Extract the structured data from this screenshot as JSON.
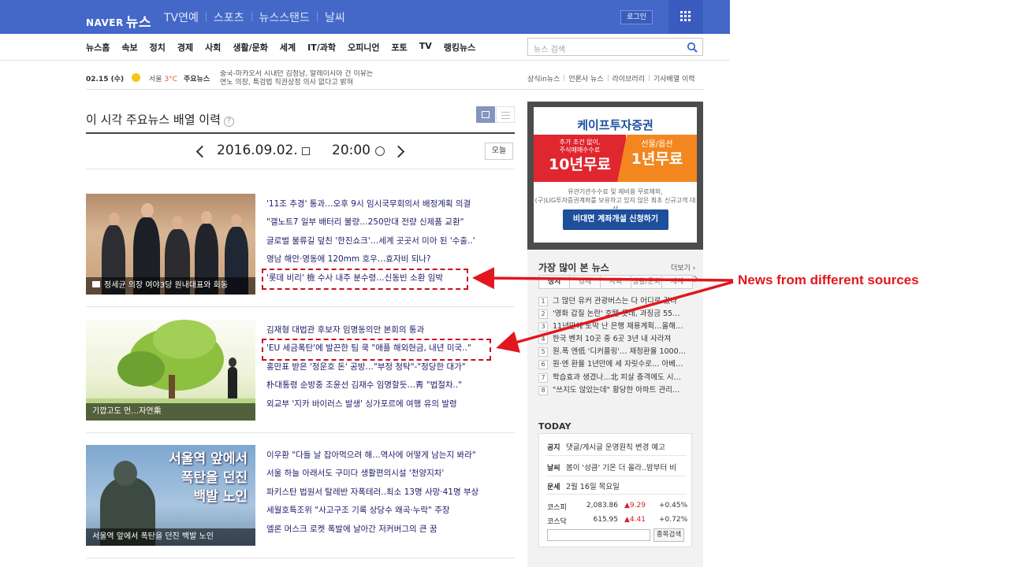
{
  "header": {
    "logo_naver": "NAVER",
    "logo_news": "뉴스",
    "nav": [
      "TV연예",
      "스포츠",
      "뉴스스탠드",
      "날씨"
    ],
    "login_label": "로그인"
  },
  "menu": [
    "뉴스홈",
    "속보",
    "정치",
    "경제",
    "사회",
    "생활/문화",
    "세계",
    "IT/과학",
    "오피니언",
    "포토",
    "TV",
    "랭킹뉴스"
  ],
  "search": {
    "placeholder": "뉴스 검색"
  },
  "date_row": {
    "date": "02.15 (수)",
    "city": "서울",
    "temp": "3°C",
    "main_label": "주요뉴스",
    "ticker_1": "중국-마카오서 시내던 김정남, 말레이시아 간 이유는",
    "ticker_2": "연노 의장, 특검법 직권상정 의사 없다고 밝혀"
  },
  "right_links": [
    "상식in뉴스",
    "언론사 뉴스",
    "라이브러리",
    "기사배열 이력"
  ],
  "section": {
    "title": "이 시각 주요뉴스 배열 이력",
    "help_icon": "?",
    "date": "2016.09.02.",
    "time": "20:00",
    "today_button": "오늘"
  },
  "news_blocks": [
    {
      "caption": "정세균 의장 여야3당 원내대표와 회동",
      "items": [
        "'11조 추경' 통과…오후 9시 임시국무회의서 배정계획 의결",
        "\"갤노트7 일부 배터리 불량…250만대 전량 신제품 교환\"",
        "글로벌 물류길 덮친 '한진쇼크'…세계 곳곳서 미아 된 '수출..'",
        "영남 해안·영동에 120mm 호우…효자비 되나?",
        "'롯데 비리' 檢 수사 내주 분수령…신동빈 소환 임박"
      ]
    },
    {
      "caption": "기깝고도 먼…자연乘",
      "items": [
        "김재형 대법관 후보자 임명동의안 본회의 통과",
        "'EU 세금폭탄'에 발끈한 팀 쿡 \"애플 해외현금, 내년 미국..\"",
        "홍만표 받은 '정운호 돈' 공방…\"부정 청탁\"-\"정당한 대가\"",
        "朴대통령 순방중 조윤선 김재수 임명할듯…靑 \"법절차..\"",
        "외교부 '지카 바이러스 발생' 싱가포르에 여행 유의 발령"
      ]
    },
    {
      "caption": "서울역 앞에서 폭탄을 던진 백발 노인",
      "image_title_1": "서울역 앞에서",
      "image_title_2": "폭탄을 던진",
      "image_title_3": "백발 노인",
      "items": [
        "이우환 \"다들 날 잡아먹으려 해…역사에 어떻게 남는지 봐라\"",
        "서울 하늘 아래서도 구미다 생활편의시설 '천양지차'",
        "파키스탄 법원서 탈레반 자폭테러..최소 13명 사망·41명 부상",
        "세월호특조위 \"사고구조 기록 상당수 왜곡·누락\" 주장",
        "엘론 머스크 로켓 폭발에 날아간 저커버그의 큰 꿈"
      ]
    }
  ],
  "ad": {
    "brand": "케이프투자증권",
    "left_small_1": "추가 조건 없이,",
    "left_small_2": "주식매매수수료",
    "left_big": "10년무료",
    "right_small": "선물/옵션",
    "right_big": "1년무료",
    "fine_1": "유관기관수수료 및 제비용 무료제외,",
    "fine_2": "(구)LIG투자증권계좌를 보유하고 있지 않은 최초 신규고객 대상",
    "cta": "비대면 계좌개설 신청하기"
  },
  "most_viewed": {
    "title": "가장 많이 본 뉴스",
    "more": "더보기",
    "tabs": [
      "정치",
      "경제",
      "사회",
      "생활/문화",
      "세계"
    ],
    "items": [
      "그 많던 유커 관광버스는 다 어디로 갔나",
      "'영화 갑질 논란' 호텔 롯데, 과징금 55…",
      "11년만에 토막 난 은행 채용계획…올해…",
      "한국 벤처 10곳 중 6곳 3년 내 사라져",
      "원.폭 엔低 '디커플링'… 재정환율 1000…",
      "원·엔 환율 1년만에 세 자릿수로… 아베…",
      "학습효과 생겼나…北 피살 충격에도 시…",
      "\"쓰지도 않았는데\" 황당한 아파트 관리…"
    ]
  },
  "today": {
    "label": "TODAY",
    "notice_label": "공지",
    "notice": "댓글/게시글 운영원칙 변경 예고",
    "weather_label": "날씨",
    "weather": "봄이 '성큼' 기온 더 올라..밤부터 비",
    "fortune_label": "운세",
    "fortune": "2월 16일 목요일",
    "stocks": [
      {
        "name": "코스피",
        "value": "2,083.86",
        "change": "▲9.29",
        "pct": "+0.45%"
      },
      {
        "name": "코스닥",
        "value": "615.95",
        "change": "▲4.41",
        "pct": "+0.72%"
      }
    ],
    "search_button": "종목검색"
  },
  "annotation": {
    "label": "News from different sources"
  },
  "colors": {
    "header": "#4468c8",
    "annotation_red": "#e3161e",
    "link_navy": "#1d1d6b"
  }
}
